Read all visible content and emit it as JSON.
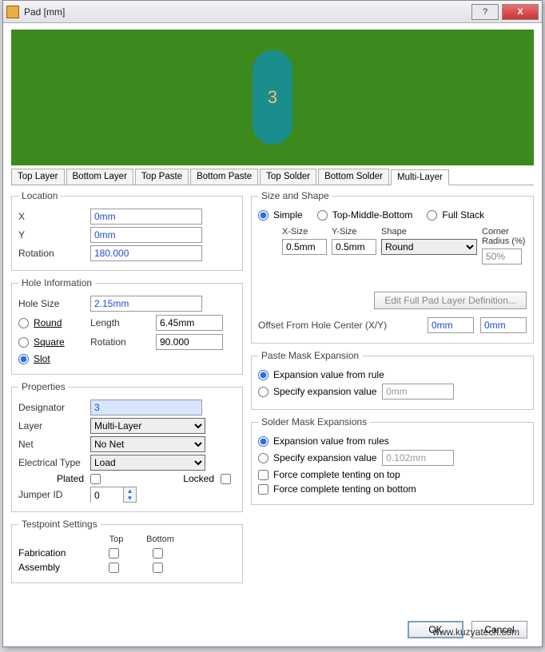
{
  "window": {
    "title": "Pad [mm]"
  },
  "preview": {
    "designator": "3"
  },
  "tabs": [
    "Top Layer",
    "Bottom Layer",
    "Top Paste",
    "Bottom Paste",
    "Top Solder",
    "Bottom Solder",
    "Multi-Layer"
  ],
  "active_tab": 6,
  "location": {
    "legend": "Location",
    "x_label": "X",
    "x": "0mm",
    "y_label": "Y",
    "y": "0mm",
    "rot_label": "Rotation",
    "rot": "180.000"
  },
  "hole": {
    "legend": "Hole Information",
    "size_label": "Hole Size",
    "size": "2.15mm",
    "round": "Round",
    "square": "Square",
    "slot": "Slot",
    "len_label": "Length",
    "len": "6.45mm",
    "rot_label": "Rotation",
    "rot": "90.000"
  },
  "props": {
    "legend": "Properties",
    "designator_label": "Designator",
    "designator": "3",
    "layer_label": "Layer",
    "layer": "Multi-Layer",
    "net_label": "Net",
    "net": "No Net",
    "etype_label": "Electrical Type",
    "etype": "Load",
    "plated_label": "Plated",
    "locked_label": "Locked",
    "jumper_label": "Jumper ID",
    "jumper": "0"
  },
  "tp": {
    "legend": "Testpoint Settings",
    "top": "Top",
    "bottom": "Bottom",
    "fab": "Fabrication",
    "asm": "Assembly"
  },
  "ss": {
    "legend": "Size and Shape",
    "simple": "Simple",
    "tmb": "Top-Middle-Bottom",
    "full": "Full Stack",
    "xsize_h": "X-Size",
    "ysize_h": "Y-Size",
    "shape_h": "Shape",
    "cr_h": "Corner\nRadius (%)",
    "xsize": "0.5mm",
    "ysize": "0.5mm",
    "shape": "Round",
    "cr": "50%",
    "editfull": "Edit Full Pad Layer Definition...",
    "offset_label": "Offset From Hole Center (X/Y)",
    "offx": "0mm",
    "offy": "0mm"
  },
  "paste": {
    "legend": "Paste Mask Expansion",
    "rule": "Expansion value from rule",
    "specify": "Specify expansion value",
    "val": "0mm"
  },
  "solder": {
    "legend": "Solder Mask Expansions",
    "rule": "Expansion value from rules",
    "specify": "Specify expansion value",
    "val": "0.102mm",
    "tent_top": "Force complete tenting on top",
    "tent_bot": "Force complete tenting on bottom"
  },
  "buttons": {
    "ok": "OK",
    "cancel": "Cancel"
  },
  "watermark": "www.kuzyatech.com"
}
